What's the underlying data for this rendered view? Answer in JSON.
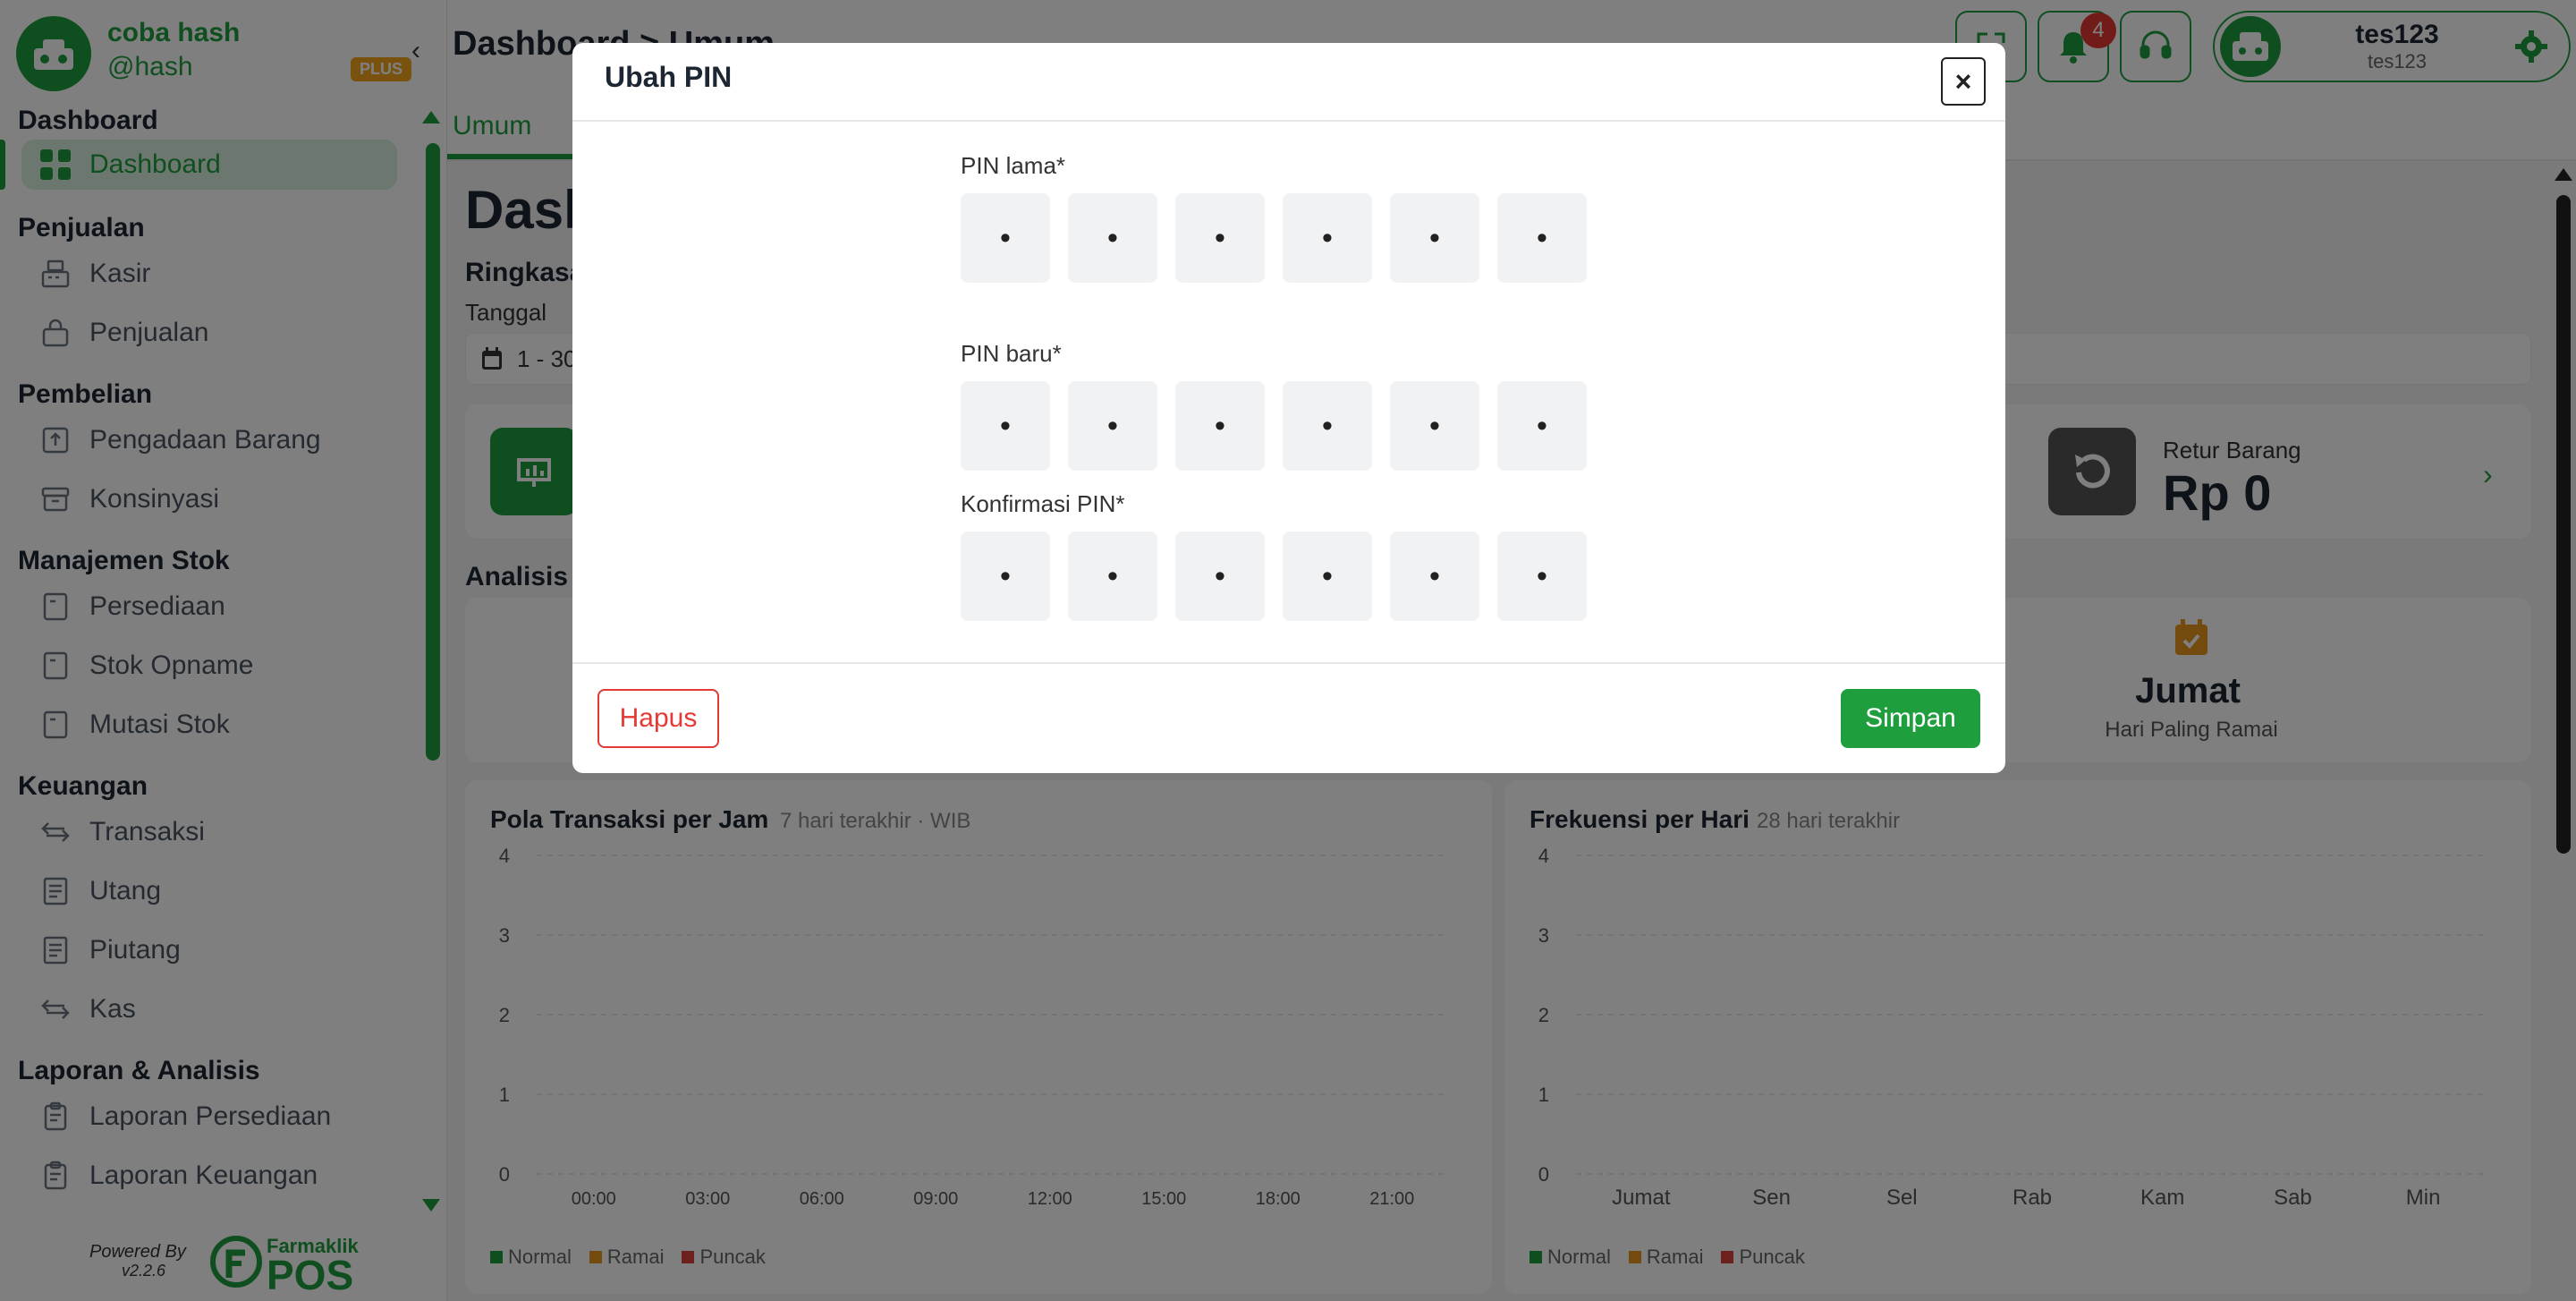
{
  "sidebar": {
    "brand_name": "coba hash",
    "brand_user": "@hash",
    "plan_badge": "PLUS",
    "sections": {
      "dashboard": "Dashboard",
      "penjualan": "Penjualan",
      "pembelian": "Pembelian",
      "manajemen_stok": "Manajemen Stok",
      "keuangan": "Keuangan",
      "laporan": "Laporan & Analisis"
    },
    "items": {
      "dashboard": "Dashboard",
      "kasir": "Kasir",
      "penjualan": "Penjualan",
      "pengadaan": "Pengadaan Barang",
      "konsinyasi": "Konsinyasi",
      "persediaan": "Persediaan",
      "stok_opname": "Stok Opname",
      "mutasi_stok": "Mutasi Stok",
      "transaksi": "Transaksi",
      "utang": "Utang",
      "piutang": "Piutang",
      "kas": "Kas",
      "laporan_persediaan": "Laporan Persediaan",
      "laporan_keuangan": "Laporan Keuangan"
    },
    "powered_by": "Powered By",
    "version": "v2.2.6",
    "footer_logo_small": "Farmaklik",
    "footer_logo_big": "POS"
  },
  "header": {
    "breadcrumb": "Dashboard > Umum",
    "notif_count": "4",
    "user_name": "tes123",
    "user_sub": "tes123",
    "accent_color": "#1f9e3e"
  },
  "tabs": {
    "active": "Umum"
  },
  "main": {
    "title": "Dashboard",
    "ringkasan": "Ringkasan",
    "tanggal_label": "Tanggal",
    "date_value": "1 - 30",
    "retur_title": "Retur Barang",
    "retur_value": "Rp 0",
    "analisis": "Analisis",
    "busiest_day": "Jumat",
    "busiest_day_label": "Hari Paling Ramai"
  },
  "chart_data": [
    {
      "type": "bar",
      "title": "Pola Transaksi per Jam",
      "subtitle": "7 hari terakhir · WIB",
      "categories": [
        "00:00",
        "03:00",
        "06:00",
        "09:00",
        "12:00",
        "15:00",
        "18:00",
        "21:00"
      ],
      "yticks": [
        "0",
        "1",
        "2",
        "3",
        "4"
      ],
      "ylim": [
        0,
        4
      ],
      "series": [
        {
          "name": "Normal",
          "color": "#1f9e3e",
          "values": [
            0,
            0,
            0,
            0,
            0,
            0,
            0,
            0
          ]
        },
        {
          "name": "Ramai",
          "color": "#e8961c",
          "values": [
            0,
            0,
            0,
            0,
            0,
            0,
            0,
            0
          ]
        },
        {
          "name": "Puncak",
          "color": "#d9423c",
          "values": [
            0,
            0,
            0,
            0,
            0,
            0,
            0,
            0
          ]
        }
      ],
      "legend_position": "bottom-left",
      "grid": true
    },
    {
      "type": "bar",
      "title": "Frekuensi per Hari",
      "subtitle": "28 hari terakhir",
      "categories": [
        "Jumat",
        "Sen",
        "Sel",
        "Rab",
        "Kam",
        "Sab",
        "Min"
      ],
      "yticks": [
        "0",
        "1",
        "2",
        "3",
        "4"
      ],
      "ylim": [
        0,
        4
      ],
      "series": [
        {
          "name": "Normal",
          "color": "#1f9e3e",
          "values": [
            0,
            0,
            0,
            0,
            0,
            0,
            0
          ]
        },
        {
          "name": "Ramai",
          "color": "#e8961c",
          "values": [
            0,
            0,
            0,
            0,
            0,
            0,
            0
          ]
        },
        {
          "name": "Puncak",
          "color": "#d9423c",
          "values": [
            0,
            0,
            0,
            0,
            0,
            0,
            0
          ]
        }
      ],
      "legend_position": "bottom-left",
      "grid": true
    }
  ],
  "modal": {
    "title": "Ubah PIN",
    "close_label": "×",
    "pin_lama_label": "PIN lama*",
    "pin_baru_label": "PIN baru*",
    "konfirmasi_label": "Konfirmasi PIN*",
    "pin_placeholder": "•",
    "hapus_label": "Hapus",
    "simpan_label": "Simpan"
  }
}
